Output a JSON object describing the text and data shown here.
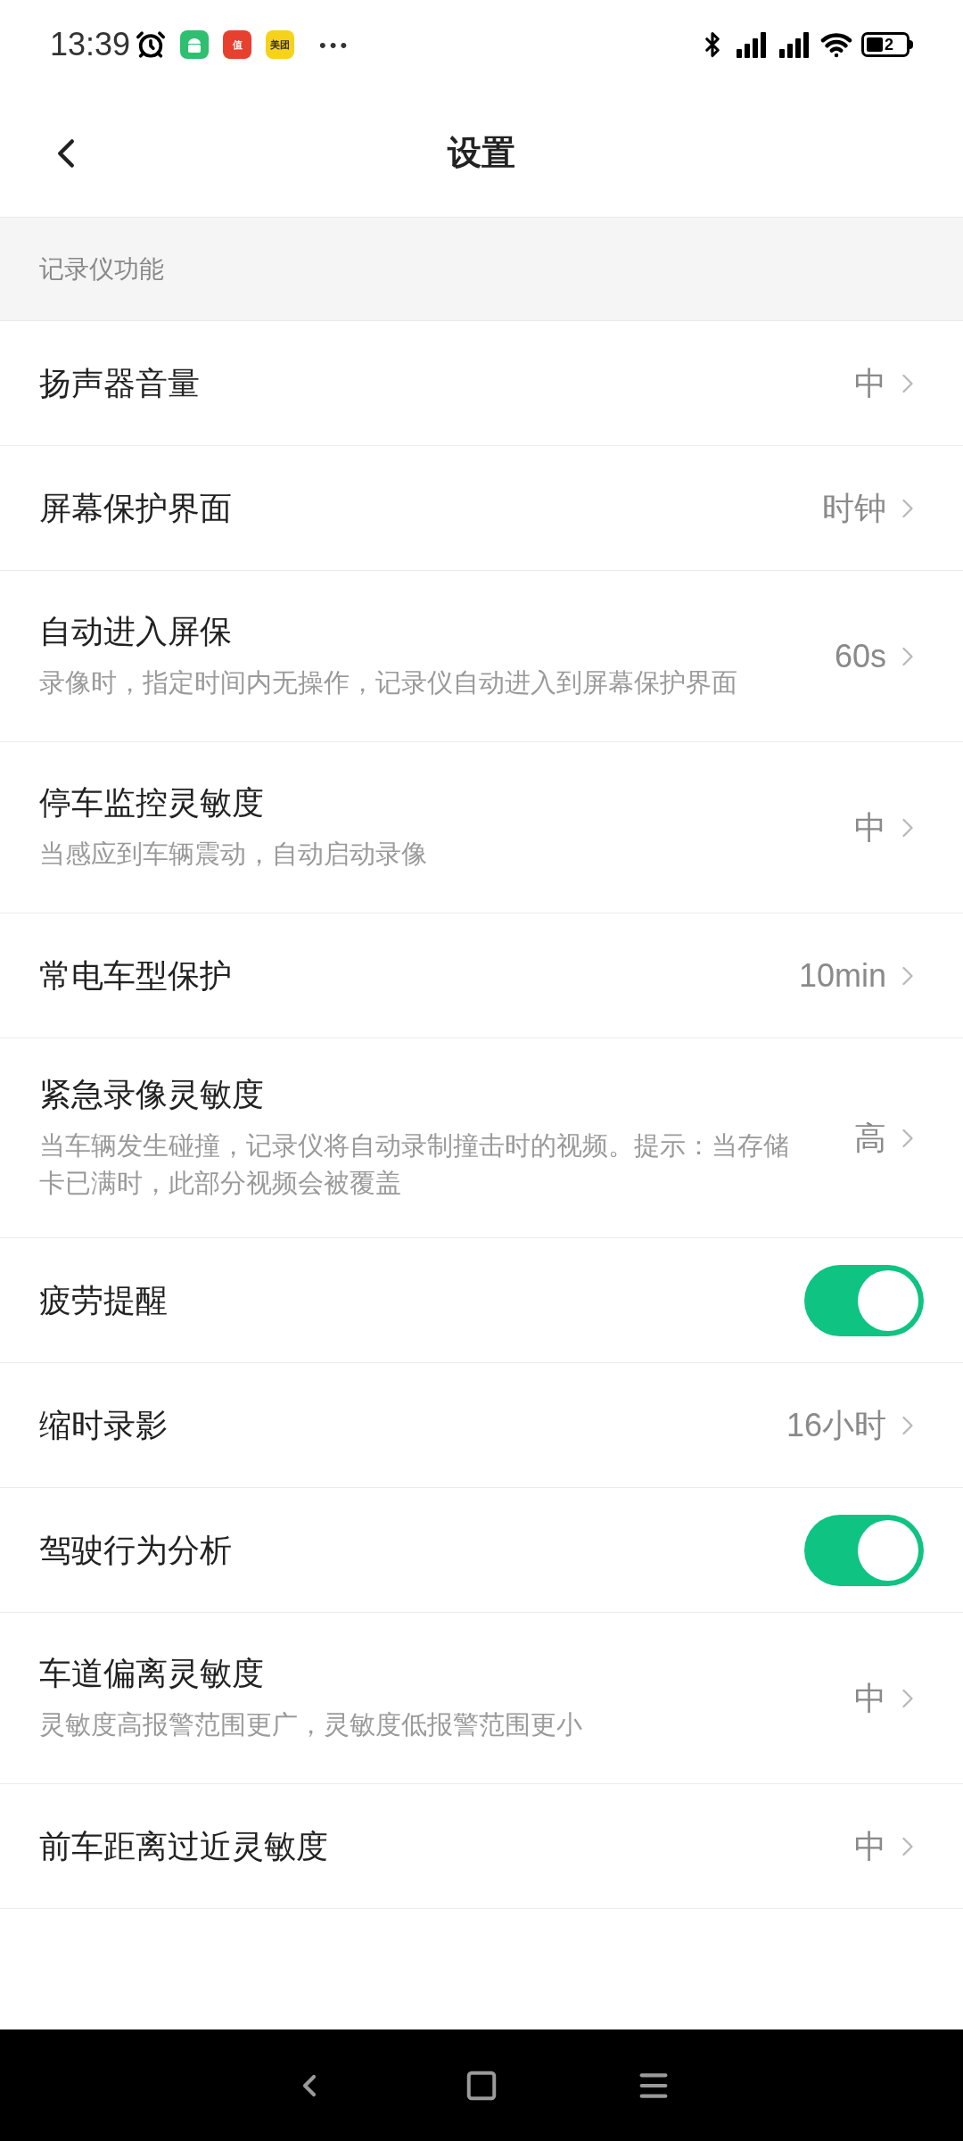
{
  "status_bar": {
    "time": "13:39",
    "app_icons": [
      {
        "kind": "android",
        "color": "#2fbf71"
      },
      {
        "kind": "letter",
        "text": "值",
        "color": "#e8402f"
      },
      {
        "kind": "letter",
        "text": "美团",
        "color": "#f7d21a"
      }
    ],
    "more": "•••",
    "battery": "2"
  },
  "header": {
    "title": "设置"
  },
  "section": {
    "title": "记录仪功能"
  },
  "rows": [
    {
      "kind": "value",
      "title": "扬声器音量",
      "value": "中"
    },
    {
      "kind": "value",
      "title": "屏幕保护界面",
      "value": "时钟"
    },
    {
      "kind": "value",
      "title": "自动进入屏保",
      "subtitle": "录像时，指定时间内无操作，记录仪自动进入到屏幕保护界面",
      "value": "60s"
    },
    {
      "kind": "value",
      "title": "停车监控灵敏度",
      "subtitle": "当感应到车辆震动，自动启动录像",
      "value": "中"
    },
    {
      "kind": "value",
      "title": "常电车型保护",
      "value": "10min"
    },
    {
      "kind": "value",
      "title": "紧急录像灵敏度",
      "subtitle": "当车辆发生碰撞，记录仪将自动录制撞击时的视频。提示：当存储卡已满时，此部分视频会被覆盖",
      "value": "高"
    },
    {
      "kind": "toggle",
      "title": "疲劳提醒",
      "on": true
    },
    {
      "kind": "value",
      "title": "缩时录影",
      "value": "16小时"
    },
    {
      "kind": "toggle",
      "title": "驾驶行为分析",
      "on": true
    },
    {
      "kind": "value",
      "title": "车道偏离灵敏度",
      "subtitle": "灵敏度高报警范围更广，灵敏度低报警范围更小",
      "value": "中"
    },
    {
      "kind": "value",
      "title": "前车距离过近灵敏度",
      "value": "中"
    }
  ]
}
